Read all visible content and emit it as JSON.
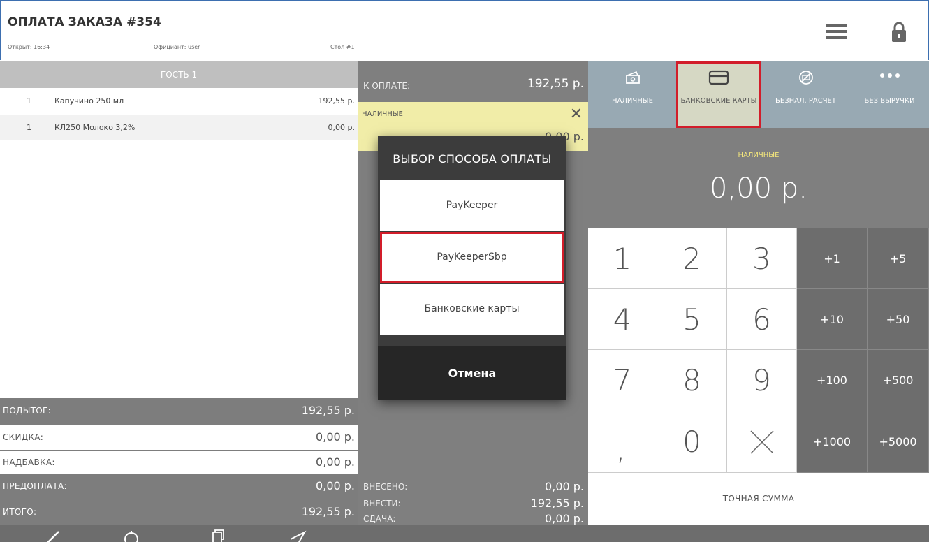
{
  "header": {
    "title": "ОПЛАТА ЗАКАЗА #354",
    "opened": "Открыт: 16:34",
    "waiter": "Официант: user",
    "table": "Стол #1"
  },
  "order": {
    "guest": "ГОСТЬ 1",
    "items": [
      {
        "qty": "1",
        "name": "Капучино 250 мл",
        "price": "192,55 р."
      },
      {
        "qty": "1",
        "name": "КЛ250 Молоко 3,2%",
        "price": "0,00 р."
      }
    ],
    "summary": {
      "subtotal_label": "ПОДЫТОГ:",
      "subtotal": "192,55 р.",
      "discount_label": "СКИДКА:",
      "discount": "0,00 р.",
      "markup_label": "НАДБАВКА:",
      "markup": "0,00 р.",
      "prepay_label": "ПРЕДОПЛАТА:",
      "prepay": "0,00 р.",
      "total_label": "ИТОГО:",
      "total": "192,55 р."
    }
  },
  "payment": {
    "topay_label": "К ОПЛАТЕ:",
    "topay": "192,55 р.",
    "cash_label": "НАЛИЧНЫЕ",
    "cash_value": "0,00 р.",
    "entered_label": "ВНЕСЕНО:",
    "entered": "0,00 р.",
    "to_enter_label": "ВНЕСТИ:",
    "to_enter": "192,55 р.",
    "change_label": "СДАЧА:",
    "change": "0,00 р."
  },
  "paytabs": [
    {
      "label": "НАЛИЧНЫЕ",
      "icon": "cash-icon"
    },
    {
      "label": "БАНКОВСКИЕ КАРТЫ",
      "icon": "card-icon",
      "active": true
    },
    {
      "label": "БЕЗНАЛ. РАСЧЕТ",
      "icon": "cashless-icon"
    },
    {
      "label": "БЕЗ ВЫРУЧКИ",
      "icon": "more-icon"
    }
  ],
  "amount": {
    "label": "НАЛИЧНЫЕ",
    "value": "0,00 р."
  },
  "numpad": {
    "digits": [
      "1",
      "2",
      "3",
      "4",
      "5",
      "6",
      "7",
      "8",
      "9",
      ",",
      "0"
    ],
    "increments": [
      "+1",
      "+5",
      "+10",
      "+50",
      "+100",
      "+500",
      "+1000",
      "+5000"
    ],
    "exact": "ТОЧНАЯ СУММА"
  },
  "modal": {
    "title": "ВЫБОР СПОСОБА ОПЛАТЫ",
    "options": [
      "PayKeeper",
      "PayKeeperSbp",
      "Банковские карты"
    ],
    "cancel": "Отмена"
  },
  "colors": {
    "highlight": "#d21d2a",
    "cash_tile": "#f1eda8",
    "amount_label": "#f4e77c",
    "panel_gray": "#7f7f7f"
  }
}
